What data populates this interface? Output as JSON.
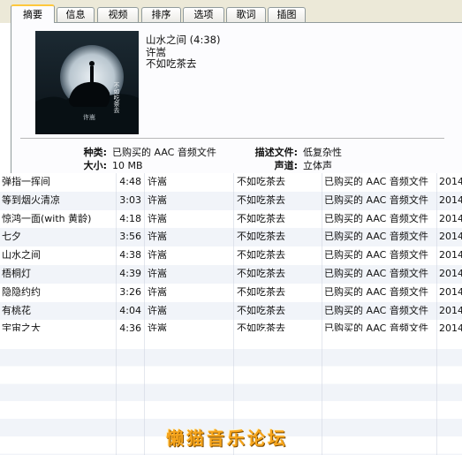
{
  "tabs": [
    {
      "label": "摘要",
      "active": true
    },
    {
      "label": "信息",
      "active": false
    },
    {
      "label": "视频",
      "active": false
    },
    {
      "label": "排序",
      "active": false
    },
    {
      "label": "选项",
      "active": false
    },
    {
      "label": "歌词",
      "active": false
    },
    {
      "label": "插图",
      "active": false
    }
  ],
  "summary": {
    "title": "山水之间 (4:38)",
    "artist": "许嵩",
    "album": "不如吃茶去",
    "artwork_text": "不如吃茶去",
    "artwork_artist": "许嵩",
    "fields": {
      "kind_label": "种类:",
      "kind_value": "已购买的 AAC 音频文件",
      "size_label": "大小:",
      "size_value": "10 MB",
      "desc_label": "描述文件:",
      "desc_value": "低复杂性",
      "channels_label": "声道:",
      "channels_value": "立体声"
    }
  },
  "tracks": [
    {
      "name": "弹指一挥间",
      "time": "4:48",
      "artist": "许嵩",
      "album": "不如吃茶去",
      "kind": "已购买的 AAC 音频文件",
      "year": "2014"
    },
    {
      "name": "等到烟火清凉",
      "time": "3:03",
      "artist": "许嵩",
      "album": "不如吃茶去",
      "kind": "已购买的 AAC 音频文件",
      "year": "2014"
    },
    {
      "name": "惊鸿一面(with 黄龄)",
      "time": "4:18",
      "artist": "许嵩",
      "album": "不如吃茶去",
      "kind": "已购买的 AAC 音频文件",
      "year": "2014"
    },
    {
      "name": "七夕",
      "time": "3:56",
      "artist": "许嵩",
      "album": "不如吃茶去",
      "kind": "已购买的 AAC 音频文件",
      "year": "2014"
    },
    {
      "name": "山水之间",
      "time": "4:38",
      "artist": "许嵩",
      "album": "不如吃茶去",
      "kind": "已购买的 AAC 音频文件",
      "year": "2014"
    },
    {
      "name": "梧桐灯",
      "time": "4:39",
      "artist": "许嵩",
      "album": "不如吃茶去",
      "kind": "已购买的 AAC 音频文件",
      "year": "2014"
    },
    {
      "name": "隐隐约约",
      "time": "3:26",
      "artist": "许嵩",
      "album": "不如吃茶去",
      "kind": "已购买的 AAC 音频文件",
      "year": "2014"
    },
    {
      "name": "有桃花",
      "time": "4:04",
      "artist": "许嵩",
      "album": "不如吃茶去",
      "kind": "已购买的 AAC 音频文件",
      "year": "2014"
    },
    {
      "name": "宇宙之大",
      "time": "4:36",
      "artist": "许嵩",
      "album": "不如吃茶去",
      "kind": "已购买的 AAC 音频文件",
      "year": "2014"
    }
  ],
  "watermark": "懒猫音乐论坛",
  "colors": {
    "active_tab_accent": "#ffc83c",
    "row_alt": "#f1f4f9",
    "watermark": "#f7a51c"
  }
}
